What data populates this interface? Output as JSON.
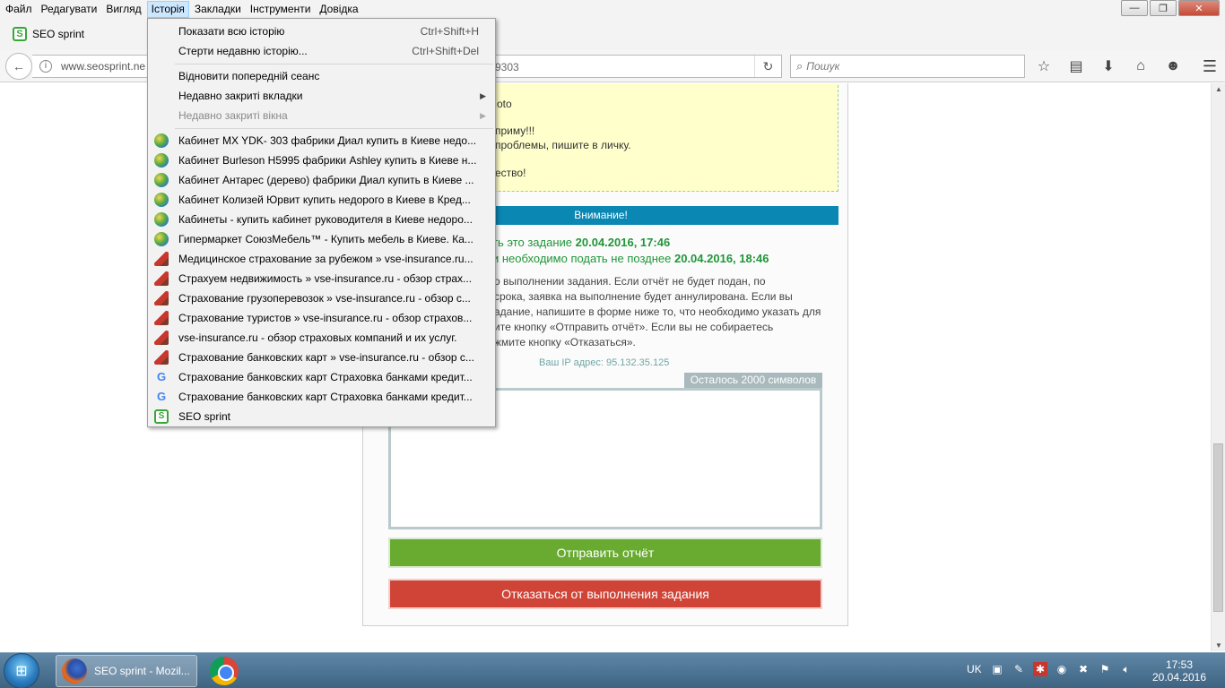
{
  "menubar": {
    "items": [
      "Файл",
      "Редагувати",
      "Вигляд",
      "Історія",
      "Закладки",
      "Інструменти",
      "Довідка"
    ],
    "active_index": 3
  },
  "window_controls": {
    "minimize": "—",
    "maximize": "❐",
    "close": "✕"
  },
  "tab": {
    "title": "SEO sprint",
    "icon": "seo-sprint-icon"
  },
  "navbar": {
    "url": "www.seosprint.ne",
    "url_suffix": "9303",
    "search_placeholder": "Пошук"
  },
  "toolbar_icons": [
    "star-icon",
    "clipboard-icon",
    "download-icon",
    "home-icon",
    "smiley-icon"
  ],
  "history_menu": {
    "items": [
      {
        "label": "Показати всю історію",
        "shortcut": "Ctrl+Shift+H"
      },
      {
        "label": "Стерти недавню історію...",
        "shortcut": "Ctrl+Shift+Del"
      },
      {
        "label": "Відновити попередній сеанс"
      },
      {
        "label": "Недавно закриті вкладки",
        "submenu": true
      },
      {
        "label": "Недавно закриті вікна",
        "submenu": true,
        "disabled": true
      }
    ],
    "history": [
      {
        "label": "Кабинет MX YDK- 303 фабрики Диал купить в Киеве недо...",
        "icon": "globe-icon"
      },
      {
        "label": "Кабинет Burleson H5995 фабрики Ashley купить в Киеве н...",
        "icon": "globe-icon"
      },
      {
        "label": "Кабинет Антарес (дерево) фабрики Диал купить в Киеве ...",
        "icon": "globe-icon"
      },
      {
        "label": "Кабинет Колизей Юрвит купить недорого в Киеве в Кред...",
        "icon": "globe-icon"
      },
      {
        "label": "Кабинеты - купить кабинет руководителя в Киеве недоро...",
        "icon": "globe-icon"
      },
      {
        "label": "Гипермаркет СоюзМебель™ - Купить мебель в Киеве. Ка...",
        "icon": "globe-icon"
      },
      {
        "label": "Медицинское страхование за рубежом » vse-insurance.ru...",
        "icon": "insurance-icon"
      },
      {
        "label": "Страхуем недвижимость » vse-insurance.ru - обзор страх...",
        "icon": "insurance-icon"
      },
      {
        "label": "Страхование грузоперевозок » vse-insurance.ru - обзор с...",
        "icon": "insurance-icon"
      },
      {
        "label": "Страхование туристов » vse-insurance.ru - обзор страхов...",
        "icon": "insurance-icon"
      },
      {
        "label": "vse-insurance.ru - обзор страховых компаний и их услуг.",
        "icon": "insurance-icon"
      },
      {
        "label": "Страхование банковских карт » vse-insurance.ru - обзор с...",
        "icon": "insurance-icon"
      },
      {
        "label": "Страхование банковских карт Страховка банками кредит...",
        "icon": "google-icon"
      },
      {
        "label": "Страхование банковских карт Страховка банками кредит...",
        "icon": "google-icon"
      },
      {
        "label": "SEO sprint",
        "icon": "seo-sprint-icon"
      }
    ]
  },
  "page": {
    "yellow_lines": [
      "oto",
      "приму!!!",
      "проблемы, пишите в личку.",
      "ество!"
    ],
    "attention": "Внимание!",
    "deadline1_prefix": "ть это задание",
    "deadline1_value": "20.04.2016, 17:46",
    "deadline2_prefix": "и необходимо подать не позднее",
    "deadline2_value": "20.04.2016, 18:46",
    "info_lines": [
      "о выполнении задания. Если отчёт не будет подан, по",
      "срока, заявка на выполнение будет аннулирована. Если вы",
      "адание, напишите в форме ниже то, что необходимо указать для",
      "ите кнопку «Отправить отчёт». Если вы не собираетесь",
      "жмите кнопку «Отказаться»."
    ],
    "ip_label": "Ваш IP адрес: 95.132.35.125",
    "char_counter": "Осталось 2000 символов",
    "textarea_value": "",
    "send_button": "Отправить отчёт",
    "refuse_button": "Отказаться от выполнения задания"
  },
  "taskbar": {
    "firefox_label": "SEO sprint - Mozil...",
    "language": "UK",
    "clock_time": "17:53",
    "clock_date": "20.04.2016"
  }
}
